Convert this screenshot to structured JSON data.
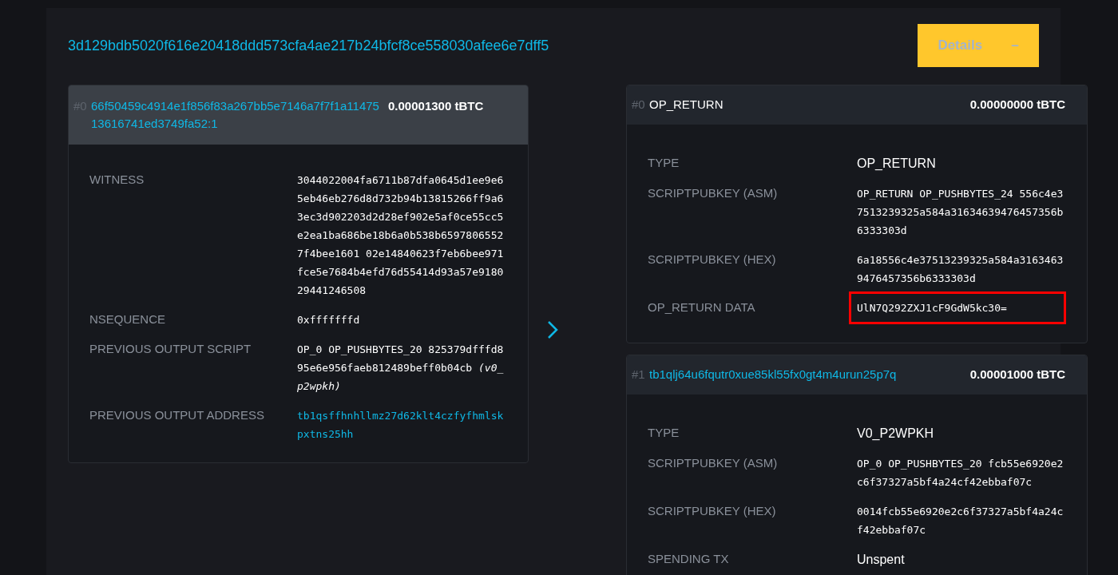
{
  "transaction": {
    "txid": "3d129bdb5020f616e20418ddd573cfa4ae217b24bfcf8ce558030afee6e7dff5",
    "details_button": {
      "label": "Details",
      "sign": "–",
      "expanded": true
    }
  },
  "inputs": [
    {
      "index": "#0",
      "outpoint": "66f50459c4914e1f856f83a267bb5e7146a7f7f1a1147513616741ed3749fa52:1",
      "amount": "0.00001300 tBTC",
      "expanded": true,
      "rows": [
        {
          "label": "WITNESS",
          "value": "3044022004fa6711b87dfa0645d1ee9e65eb46eb276d8d732b94b13815266ff9a63ec3d902203d2d28ef902e5af0ce55cc5e2ea1ba686be18b6a0b538b65978065527f4bee1601 02e14840623f7eb6bee971fce5e7684b4efd76d55414d93a57e918029441246508",
          "kind": "mono",
          "highlighted": false
        },
        {
          "label": "NSEQUENCE",
          "value": "0xfffffffd",
          "kind": "mono",
          "highlighted": false
        },
        {
          "label": "PREVIOUS OUTPUT SCRIPT",
          "value": "OP_0 OP_PUSHBYTES_20 825379dfffd895e6e956faeb812489beff0b04cb *(v0_p2wpkh)*",
          "kind": "mono",
          "highlighted": false
        },
        {
          "label": "PREVIOUS OUTPUT ADDRESS",
          "value": "tb1qsffhnhllmz27d62klt4czfyfhmlskpxtns25hh",
          "kind": "link",
          "highlighted": false
        }
      ]
    }
  ],
  "outputs": [
    {
      "index": "#0",
      "title": "OP_RETURN",
      "kind": "text",
      "amount": "0.00000000 tBTC",
      "rows": [
        {
          "label": "TYPE",
          "value": "OP_RETURN",
          "kind": "text",
          "highlighted": false
        },
        {
          "label": "SCRIPTPUBKEY (ASM)",
          "value": "OP_RETURN OP_PUSHBYTES_24 556c4e37513239325a584a31634639476457356b6333303d",
          "kind": "mono",
          "highlighted": false
        },
        {
          "label": "SCRIPTPUBKEY (HEX)",
          "value": "6a18556c4e37513239325a584a31634639476457356b6333303d",
          "kind": "mono",
          "highlighted": false
        },
        {
          "label": "OP_RETURN DATA",
          "value": "UlN7Q292ZXJ1cF9GdW5kc30=",
          "kind": "mono",
          "highlighted": true
        }
      ]
    },
    {
      "index": "#1",
      "title": "tb1qlj64u6fqutr0xue85kl55fx0gt4m4urun25p7q",
      "kind": "link",
      "amount": "0.00001000 tBTC",
      "rows": [
        {
          "label": "TYPE",
          "value": "V0_P2WPKH",
          "kind": "text",
          "highlighted": false
        },
        {
          "label": "SCRIPTPUBKEY (ASM)",
          "value": "OP_0 OP_PUSHBYTES_20 fcb55e6920e2c6f37327a5bf4a24cf42ebbaf07c",
          "kind": "mono",
          "highlighted": false
        },
        {
          "label": "SCRIPTPUBKEY (HEX)",
          "value": "0014fcb55e6920e2c6f37327a5bf4a24cf42ebbaf07c",
          "kind": "mono",
          "highlighted": false
        },
        {
          "label": "SPENDING TX",
          "value": "Unspent",
          "kind": "text",
          "highlighted": false
        }
      ]
    }
  ]
}
